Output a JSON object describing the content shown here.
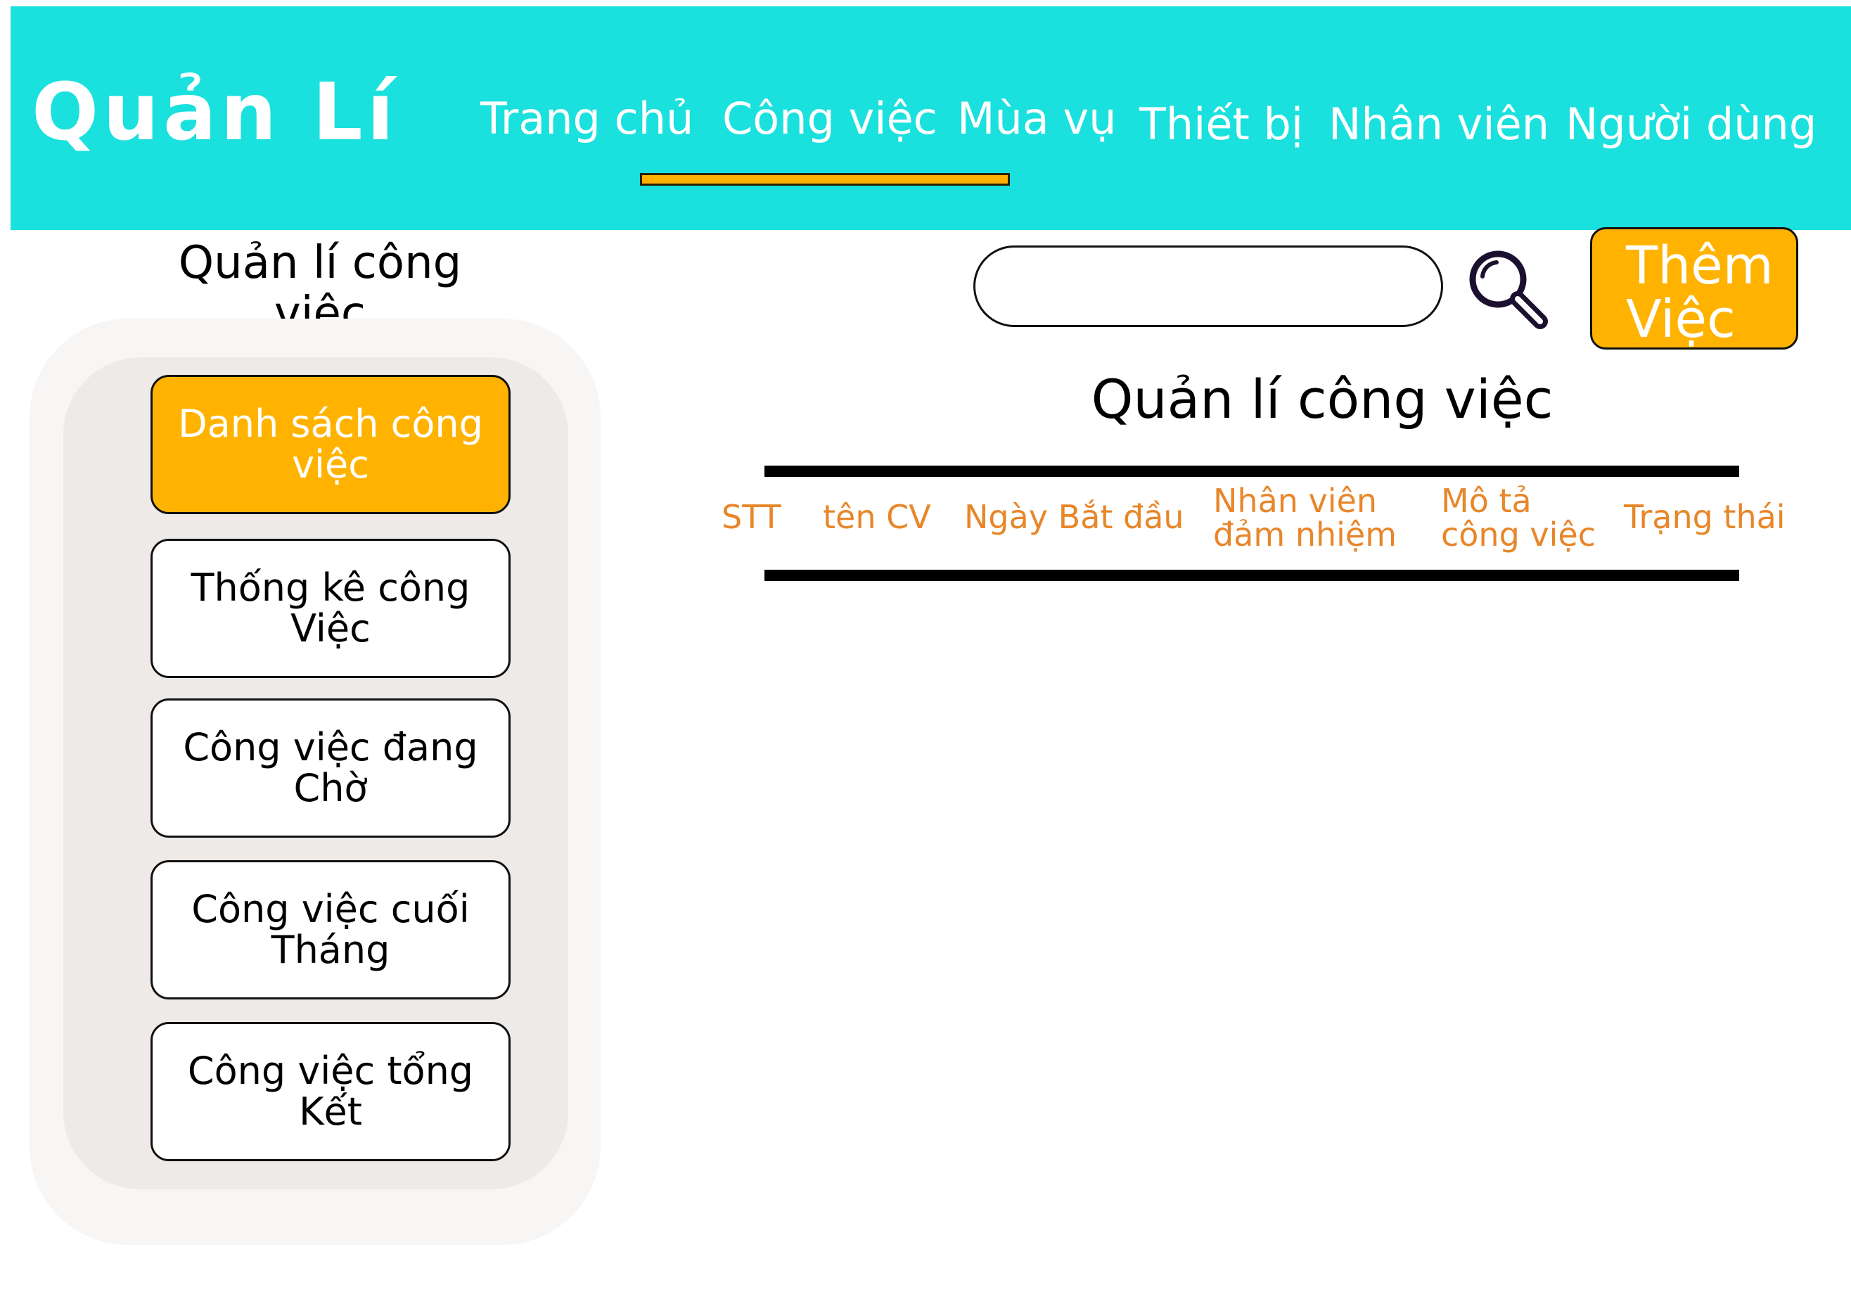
{
  "header": {
    "brand": "Quản Lí",
    "nav": [
      {
        "label": "Trang chủ"
      },
      {
        "label": "Công việc",
        "active": true
      },
      {
        "label": "Mùa vụ"
      },
      {
        "label": "Thiết bị"
      },
      {
        "label": "Nhân viên"
      },
      {
        "label": "Người dùng"
      }
    ]
  },
  "sidebar": {
    "title": "Quản lí công việc",
    "items": [
      {
        "label": "Danh sách công việc",
        "active": true
      },
      {
        "label_line1": "Thống kê công",
        "label_line2": "Việc"
      },
      {
        "label_line1": "Công việc đang",
        "label_line2": "Chờ"
      },
      {
        "label_line1": "Công việc cuối",
        "label_line2": "Tháng"
      },
      {
        "label_line1": "Công việc tổng",
        "label_line2": "Kết"
      }
    ]
  },
  "toolbar": {
    "search_value": "",
    "add_button_line1": "Thêm",
    "add_button_line2": "Việc"
  },
  "main": {
    "title": "Quản lí công việc",
    "columns": [
      {
        "line1": "STT"
      },
      {
        "line1": "tên CV"
      },
      {
        "line1": "Ngày Bắt đầu"
      },
      {
        "line1": "Nhân viên",
        "line2": "đảm nhiệm"
      },
      {
        "line1": "Mô tả",
        "line2": "công việc"
      },
      {
        "line1": "Trạng thái"
      }
    ]
  },
  "colors": {
    "header_bg": "#1ae0de",
    "accent": "#ffb300",
    "column_text": "#e8862a"
  },
  "icons": {
    "search": "search-icon"
  }
}
